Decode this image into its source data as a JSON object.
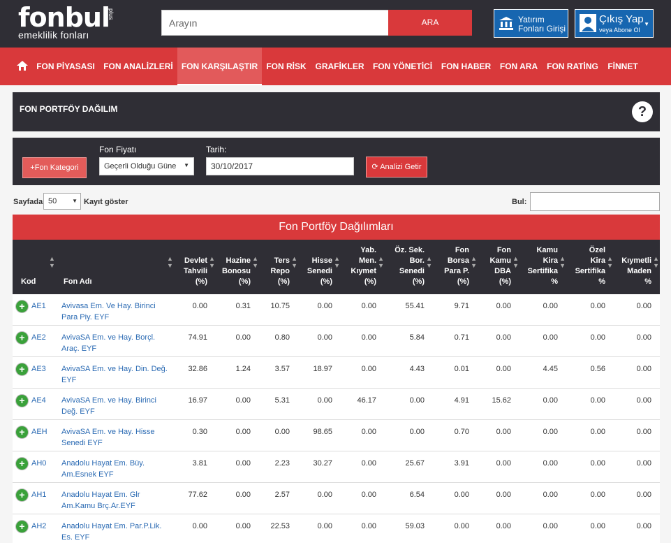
{
  "header": {
    "logo_brand": "fonbul",
    "logo_plus": "plus",
    "logo_sub": "emeklilik fonları",
    "search_placeholder": "Arayın",
    "search_button": "ARA",
    "invest_line1": "Yatırım",
    "invest_line2": "Fonları Girişi",
    "user_line1": "Çıkış Yap",
    "user_line2": "veya Abone Ol"
  },
  "nav": {
    "items": [
      {
        "label": "FON PİYASASI"
      },
      {
        "label": "FON ANALİZLERİ"
      },
      {
        "label": "FON KARŞILAŞTIR"
      },
      {
        "label": "FON RİSK"
      },
      {
        "label": "GRAFİKLER"
      },
      {
        "label": "FON YÖNETİCİ"
      },
      {
        "label": "FON HABER"
      },
      {
        "label": "FON ARA"
      },
      {
        "label": "FON RATİNG"
      },
      {
        "label": "FİNNET"
      }
    ],
    "active_index": 2
  },
  "page": {
    "title": "FON PORTFÖY DAĞILIM"
  },
  "filters": {
    "category_button": "+Fon Kategori",
    "price_label": "Fon Fiyatı",
    "price_value": "Geçerli Olduğu Güne",
    "date_label": "Tarih:",
    "date_value": "30/10/2017",
    "analyze_button": "Analizi Getir"
  },
  "table_controls": {
    "page_label": "Sayfada",
    "page_size": "50",
    "show_label": "Kayıt göster",
    "find_label": "Bul:"
  },
  "table": {
    "title": "Fon Portföy Dağılımları",
    "columns": [
      "Kod",
      "Fon Adı",
      "Devlet\nTahvili\n(%)",
      "Hazine\nBonosu\n(%)",
      "Ters\nRepo\n(%)",
      "Hisse\nSenedi\n(%)",
      "Yab.\nMen.\nKıymet\n(%)",
      "Öz. Sek.\nBor.\nSenedi\n(%)",
      "Fon\nBorsa\nPara P.\n(%)",
      "Fon\nKamu\nDBA\n(%)",
      "Kamu\nKira\nSertifika\n%",
      "Özel\nKira\nSertifika\n%",
      "Kıymetli\nMaden\n%"
    ],
    "rows": [
      {
        "code": "AE1",
        "name": "Avivasa Em. Ve Hay. Birinci Para Piy. EYF",
        "v": [
          "0.00",
          "0.31",
          "10.75",
          "0.00",
          "0.00",
          "55.41",
          "9.71",
          "0.00",
          "0.00",
          "0.00",
          "0.00"
        ]
      },
      {
        "code": "AE2",
        "name": "AvivaSA Em. ve Hay. Borçl. Araç. EYF",
        "v": [
          "74.91",
          "0.00",
          "0.80",
          "0.00",
          "0.00",
          "5.84",
          "0.71",
          "0.00",
          "0.00",
          "0.00",
          "0.00"
        ]
      },
      {
        "code": "AE3",
        "name": "AvivaSA Em. ve Hay. Din. Değ. EYF",
        "v": [
          "32.86",
          "1.24",
          "3.57",
          "18.97",
          "0.00",
          "4.43",
          "0.01",
          "0.00",
          "4.45",
          "0.56",
          "0.00"
        ]
      },
      {
        "code": "AE4",
        "name": "AvivaSA Em. ve Hay. Birinci Değ. EYF",
        "v": [
          "16.97",
          "0.00",
          "5.31",
          "0.00",
          "46.17",
          "0.00",
          "4.91",
          "15.62",
          "0.00",
          "0.00",
          "0.00"
        ]
      },
      {
        "code": "AEH",
        "name": "AvivaSA Em. ve Hay. Hisse Senedi EYF",
        "v": [
          "0.30",
          "0.00",
          "0.00",
          "98.65",
          "0.00",
          "0.00",
          "0.70",
          "0.00",
          "0.00",
          "0.00",
          "0.00"
        ]
      },
      {
        "code": "AH0",
        "name": "Anadolu Hayat Em. Büy. Am.Esnek EYF",
        "v": [
          "3.81",
          "0.00",
          "2.23",
          "30.27",
          "0.00",
          "25.67",
          "3.91",
          "0.00",
          "0.00",
          "0.00",
          "0.00"
        ]
      },
      {
        "code": "AH1",
        "name": "Anadolu Hayat Em. Glr Am.Kamu Brç.Ar.EYF",
        "v": [
          "77.62",
          "0.00",
          "2.57",
          "0.00",
          "0.00",
          "6.54",
          "0.00",
          "0.00",
          "0.00",
          "0.00",
          "0.00"
        ]
      },
      {
        "code": "AH2",
        "name": "Anadolu Hayat Em. Par.P.Lik. Es. EYF",
        "v": [
          "0.00",
          "0.00",
          "22.53",
          "0.00",
          "0.00",
          "59.03",
          "0.00",
          "0.00",
          "0.00",
          "0.00",
          "0.00"
        ]
      }
    ]
  }
}
